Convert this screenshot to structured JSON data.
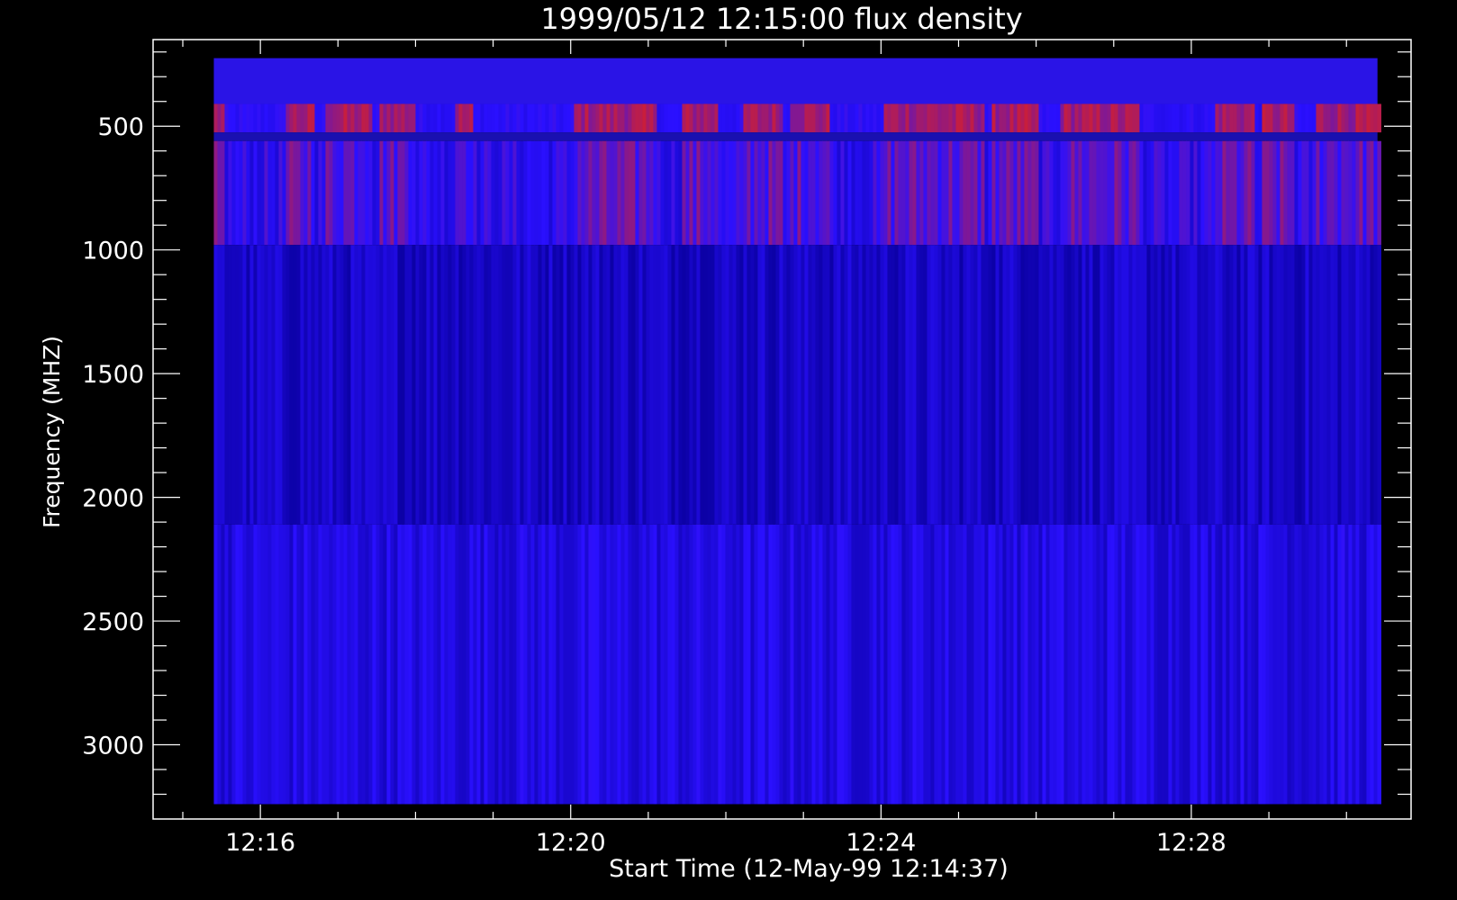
{
  "colors": {
    "background": "#000000",
    "axis": "#ffffff",
    "low": "#1400d8",
    "mid": "#2a10ff",
    "high": "#c81e3c"
  },
  "chart_data": {
    "type": "heatmap",
    "title": "1999/05/12 12:15:00 flux density",
    "xlabel": "Start Time (12-May-99 12:14:37)",
    "ylabel": "Frequency (MHZ)",
    "x_tick_labels": [
      "12:16",
      "12:20",
      "12:24",
      "12:28"
    ],
    "x_ticks_minutes": [
      16,
      20,
      24,
      28
    ],
    "xlim_minutes": [
      14.617,
      30.833
    ],
    "data_x_range_minutes": [
      15.4,
      30.4
    ],
    "y_tick_labels": [
      "500",
      "1000",
      "1500",
      "2000",
      "2500",
      "3000"
    ],
    "y_ticks": [
      500,
      1000,
      1500,
      2000,
      2500,
      3000
    ],
    "ylim": [
      3300,
      150
    ],
    "y_reversed": true,
    "data_y_range": [
      225,
      3240
    ],
    "colorscale": [
      "#0a00a0",
      "#2a10ff",
      "#c81e3c"
    ],
    "bands": [
      {
        "name": "band-1",
        "freq_range": [
          225,
          980
        ],
        "mean_level": 0.45
      },
      {
        "name": "band-2",
        "freq_range": [
          980,
          2110
        ],
        "mean_level": 0.2
      },
      {
        "name": "band-3",
        "freq_range": [
          2110,
          3240
        ],
        "mean_level": 0.35
      }
    ],
    "burst_segments_minutes": [
      [
        15.4,
        15.5
      ],
      [
        16.3,
        16.7
      ],
      [
        16.8,
        17.4
      ],
      [
        17.5,
        18.0
      ],
      [
        18.5,
        18.7
      ],
      [
        20.0,
        21.1
      ],
      [
        21.4,
        21.9
      ],
      [
        22.2,
        22.7
      ],
      [
        22.8,
        23.3
      ],
      [
        24.0,
        24.8
      ],
      [
        24.8,
        25.3
      ],
      [
        25.4,
        26.0
      ],
      [
        26.3,
        27.3
      ],
      [
        28.3,
        28.8
      ],
      [
        28.9,
        29.3
      ],
      [
        29.6,
        30.4
      ]
    ]
  }
}
